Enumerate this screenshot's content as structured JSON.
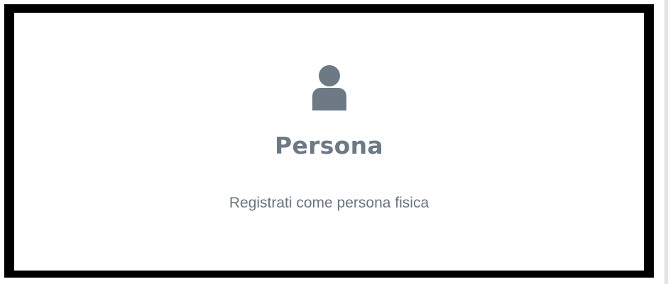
{
  "card": {
    "title": "Persona",
    "subtitle": "Registrati come persona fisica",
    "icon": "user-icon"
  },
  "colors": {
    "icon": "#6d7a85",
    "title": "#6d7a85",
    "subtitle": "#6b747d",
    "border": "#000000",
    "background": "#ffffff"
  }
}
